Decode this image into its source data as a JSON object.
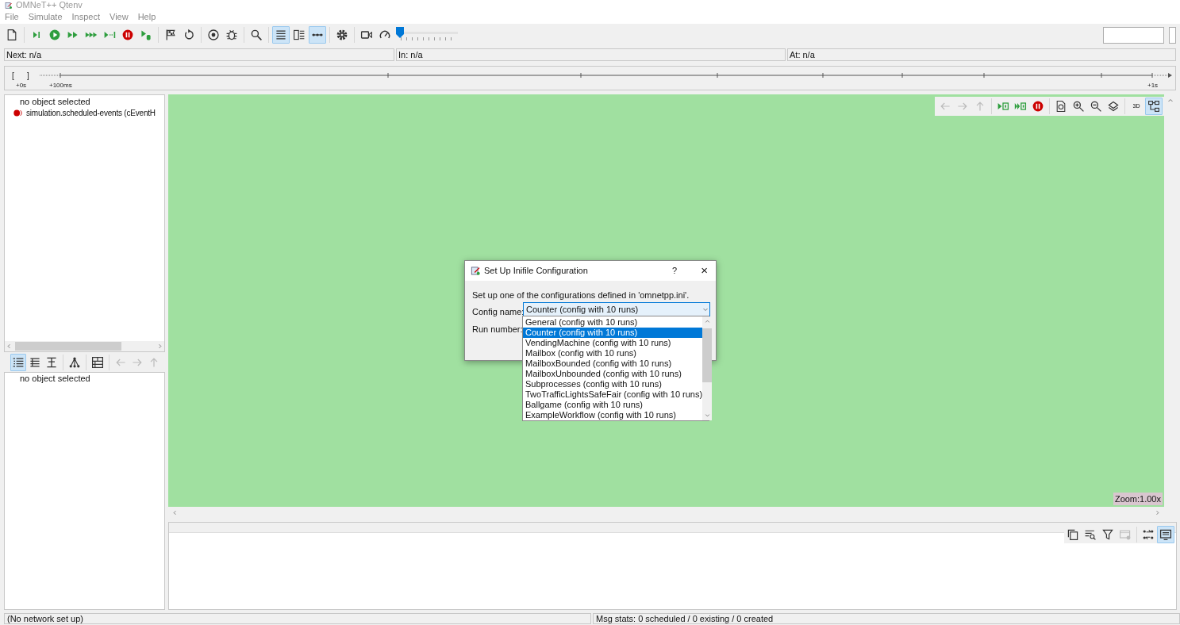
{
  "window": {
    "title": "OMNeT++ Qtenv"
  },
  "menu": [
    "File",
    "Simulate",
    "Inspect",
    "View",
    "Help"
  ],
  "toolbar": {
    "toggles": [
      {
        "on": true
      },
      {
        "on": false
      },
      {
        "on": true
      }
    ],
    "speed_slider": {
      "level": 0
    }
  },
  "status_fields": [
    "Next: n/a",
    "In: n/a",
    "At: n/a"
  ],
  "timeline": {
    "brackets": [
      "[",
      "]"
    ],
    "labels": [
      "+0s",
      "+100ms",
      "+1s"
    ]
  },
  "object_tree": {
    "items": [
      {
        "label": "no object selected",
        "kind": "text"
      },
      {
        "label": "simulation.scheduled-events (cEventH",
        "kind": "event-queue"
      }
    ]
  },
  "inspector_toolbar": {
    "modes": [
      {
        "selected": true
      },
      {
        "selected": false
      },
      {
        "selected": false
      },
      {
        "selected": false
      }
    ]
  },
  "inspector": {
    "text": "no object selected"
  },
  "network_canvas": {
    "zoom": "Zoom:1.00x",
    "toolbar": {
      "label_3d": "3D",
      "toggles": [
        {
          "on": false
        },
        {
          "on": true
        }
      ]
    }
  },
  "log": {
    "toolbar_toggles": [
      {
        "on": false
      },
      {
        "on": true
      }
    ]
  },
  "dialog": {
    "title": "Set Up Inifile Configuration",
    "help": "?",
    "close": "×",
    "message": "Set up one of the configurations defined in 'omnetpp.ini'.",
    "config_label": "Config name:",
    "config_value": "Counter (config with 10 runs)",
    "run_label": "Run number:",
    "options": [
      {
        "label": "General (config with 10 runs)",
        "selected": false
      },
      {
        "label": "Counter (config with 10 runs)",
        "selected": true
      },
      {
        "label": "VendingMachine (config with 10 runs)",
        "selected": false
      },
      {
        "label": "Mailbox (config with 10 runs)",
        "selected": false
      },
      {
        "label": "MailboxBounded (config with 10 runs)",
        "selected": false
      },
      {
        "label": "MailboxUnbounded (config with 10 runs)",
        "selected": false
      },
      {
        "label": "Subprocesses (config with 10 runs)",
        "selected": false
      },
      {
        "label": "TwoTrafficLightsSafeFair (config with 10 runs)",
        "selected": false
      },
      {
        "label": "Ballgame (config with 10 runs)",
        "selected": false
      },
      {
        "label": "ExampleWorkflow (config with 10 runs)",
        "selected": false
      }
    ]
  },
  "status_bar": [
    "(No network set up)",
    "Msg stats: 0 scheduled / 0 existing / 0 created"
  ]
}
